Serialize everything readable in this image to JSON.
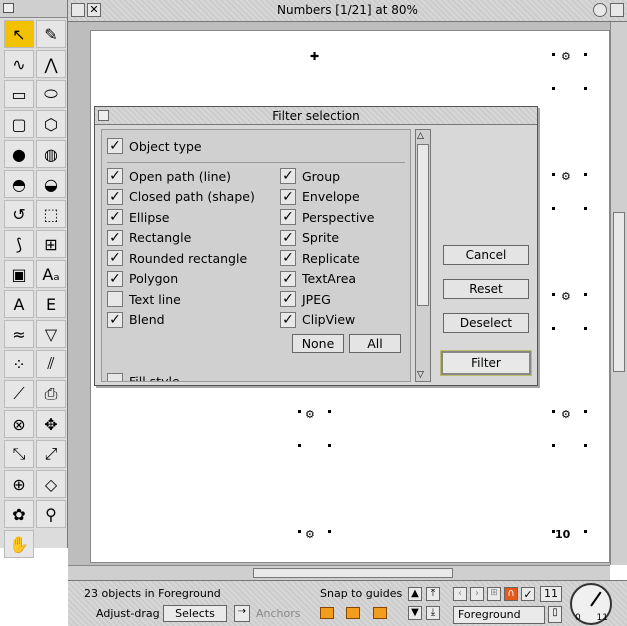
{
  "window": {
    "title": "Numbers [1/21] at 80%"
  },
  "toolbox": {
    "tools": [
      {
        "name": "select-tool",
        "glyph": "↖",
        "selected": true
      },
      {
        "name": "freehand-tool",
        "glyph": "✎"
      },
      {
        "name": "curve-tool",
        "glyph": "∿"
      },
      {
        "name": "line-tool",
        "glyph": "⋀"
      },
      {
        "name": "rectangle-tool",
        "glyph": "▭"
      },
      {
        "name": "ellipse-tool",
        "glyph": "⬭"
      },
      {
        "name": "rounded-rectangle-tool",
        "glyph": "▢"
      },
      {
        "name": "polygon-tool",
        "glyph": "⬡"
      },
      {
        "name": "fill-colour-tool",
        "glyph": "●"
      },
      {
        "name": "pattern-fill-tool",
        "glyph": "◍"
      },
      {
        "name": "sphere-tool",
        "glyph": "◓"
      },
      {
        "name": "shade-sphere-tool",
        "glyph": "◒"
      },
      {
        "name": "rotate-tool",
        "glyph": "↺"
      },
      {
        "name": "transform-tool",
        "glyph": "⬚"
      },
      {
        "name": "blend-tool",
        "glyph": "⟆"
      },
      {
        "name": "grid-tool",
        "glyph": "⊞"
      },
      {
        "name": "sprite-tool",
        "glyph": "▣"
      },
      {
        "name": "text-tool",
        "glyph": "Aₐ"
      },
      {
        "name": "textarea-tool",
        "glyph": "A"
      },
      {
        "name": "text-frame-tool",
        "glyph": "E"
      },
      {
        "name": "envelope-tool",
        "glyph": "≈"
      },
      {
        "name": "perspective-tool",
        "glyph": "▽"
      },
      {
        "name": "replicate-tool",
        "glyph": "⁘"
      },
      {
        "name": "brush-tool",
        "glyph": "⫽"
      },
      {
        "name": "magic-wand-tool",
        "glyph": "⟋"
      },
      {
        "name": "sprite-insert-tool",
        "glyph": "⎙"
      },
      {
        "name": "clip-tool",
        "glyph": "⊗"
      },
      {
        "name": "move-tool",
        "glyph": "✥"
      },
      {
        "name": "snap-tool",
        "glyph": "⤡"
      },
      {
        "name": "scale-tool",
        "glyph": "⤢"
      },
      {
        "name": "frame-tool",
        "glyph": "⊕"
      },
      {
        "name": "gem-tool",
        "glyph": "◇"
      },
      {
        "name": "flower-tool",
        "glyph": "✿"
      },
      {
        "name": "zoom-tool",
        "glyph": "⚲"
      },
      {
        "name": "hand-tool",
        "glyph": "✋"
      }
    ]
  },
  "page": {
    "markers": [
      "✚",
      "⚙",
      "⚙",
      "⚙",
      "⚙",
      "⚙",
      "⚙",
      "10"
    ]
  },
  "dialog": {
    "title": "Filter selection",
    "group_label": "Object type",
    "left_items": [
      {
        "label": "Open path (line)",
        "checked": true
      },
      {
        "label": "Closed path (shape)",
        "checked": true
      },
      {
        "label": "Ellipse",
        "checked": true
      },
      {
        "label": "Rectangle",
        "checked": true
      },
      {
        "label": "Rounded rectangle",
        "checked": true
      },
      {
        "label": "Polygon",
        "checked": true
      },
      {
        "label": "Text line",
        "checked": false
      },
      {
        "label": "Blend",
        "checked": true
      }
    ],
    "right_items": [
      {
        "label": "Group",
        "checked": true
      },
      {
        "label": "Envelope",
        "checked": true
      },
      {
        "label": "Perspective",
        "checked": true
      },
      {
        "label": "Sprite",
        "checked": true
      },
      {
        "label": "Replicate",
        "checked": true
      },
      {
        "label": "TextArea",
        "checked": true
      },
      {
        "label": "JPEG",
        "checked": true
      },
      {
        "label": "ClipView",
        "checked": true
      }
    ],
    "none_label": "None",
    "all_label": "All",
    "fill_style_label": "Fill style",
    "buttons": {
      "cancel": "Cancel",
      "reset": "Reset",
      "deselect": "Deselect",
      "filter": "Filter"
    }
  },
  "status": {
    "objects_text": "23 objects in Foreground",
    "snap_label": "Snap to guides",
    "adjust_label": "Adjust-drag",
    "selects_value": "Selects",
    "anchors_label": "Anchors",
    "layer_value": "Foreground",
    "layer_count": "11",
    "dial_min": "0",
    "dial_max": "11"
  },
  "colors": {
    "accent": "#f2c200",
    "snap": "#f29d1c",
    "danger": "#e45a1a"
  }
}
